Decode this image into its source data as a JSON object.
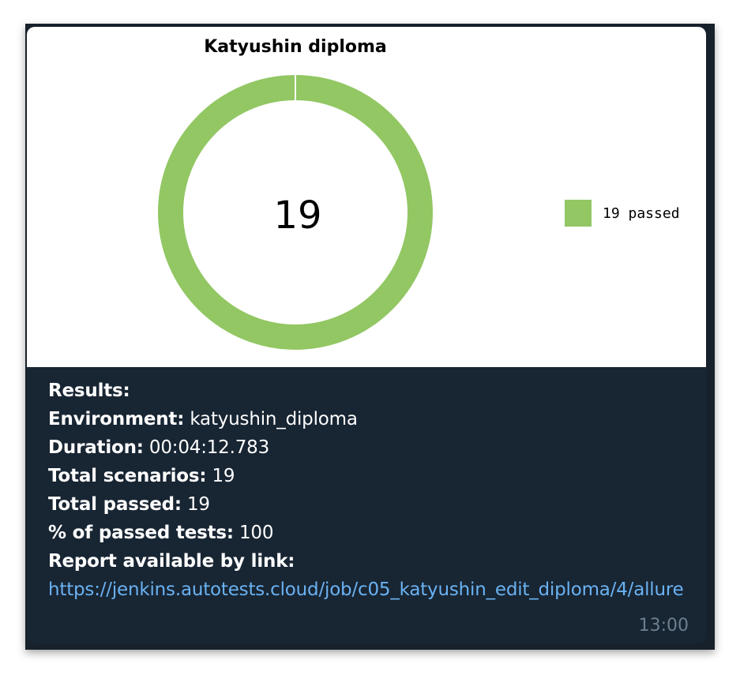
{
  "message": {
    "results_heading": "Results:",
    "fields": [
      {
        "label": "Environment:",
        "value": "katyushin_diploma"
      },
      {
        "label": "Duration:",
        "value": "00:04:12.783"
      },
      {
        "label": "Total scenarios:",
        "value": "19"
      },
      {
        "label": "Total passed:",
        "value": "19"
      },
      {
        "label": "% of passed tests:",
        "value": "100"
      }
    ],
    "report_label": "Report available by link:",
    "report_link": "https://jenkins.autotests.cloud/job/c05_katyushin_edit_diploma/4/allure",
    "time": "13:00"
  },
  "chart_data": {
    "type": "pie",
    "title": "Katyushin diploma",
    "center_label": "19",
    "slices": [
      {
        "label": "19 passed",
        "value": 19,
        "color": "#92c763"
      }
    ],
    "legend_position": "right"
  }
}
